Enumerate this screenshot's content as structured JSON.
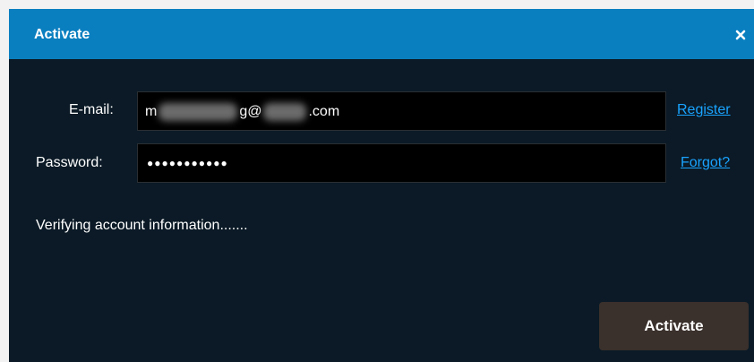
{
  "dialog": {
    "title": "Activate",
    "close_icon": "close-icon"
  },
  "form": {
    "email_label": "E-mail:",
    "email_prefix": "m",
    "email_mid": "g@",
    "email_suffix": ".com",
    "password_label": "Password:",
    "password_value": "●●●●●●●●●●●",
    "register_link": "Register",
    "forgot_link": "Forgot?"
  },
  "status": {
    "text": "Verifying account information......."
  },
  "actions": {
    "activate_label": "Activate"
  }
}
